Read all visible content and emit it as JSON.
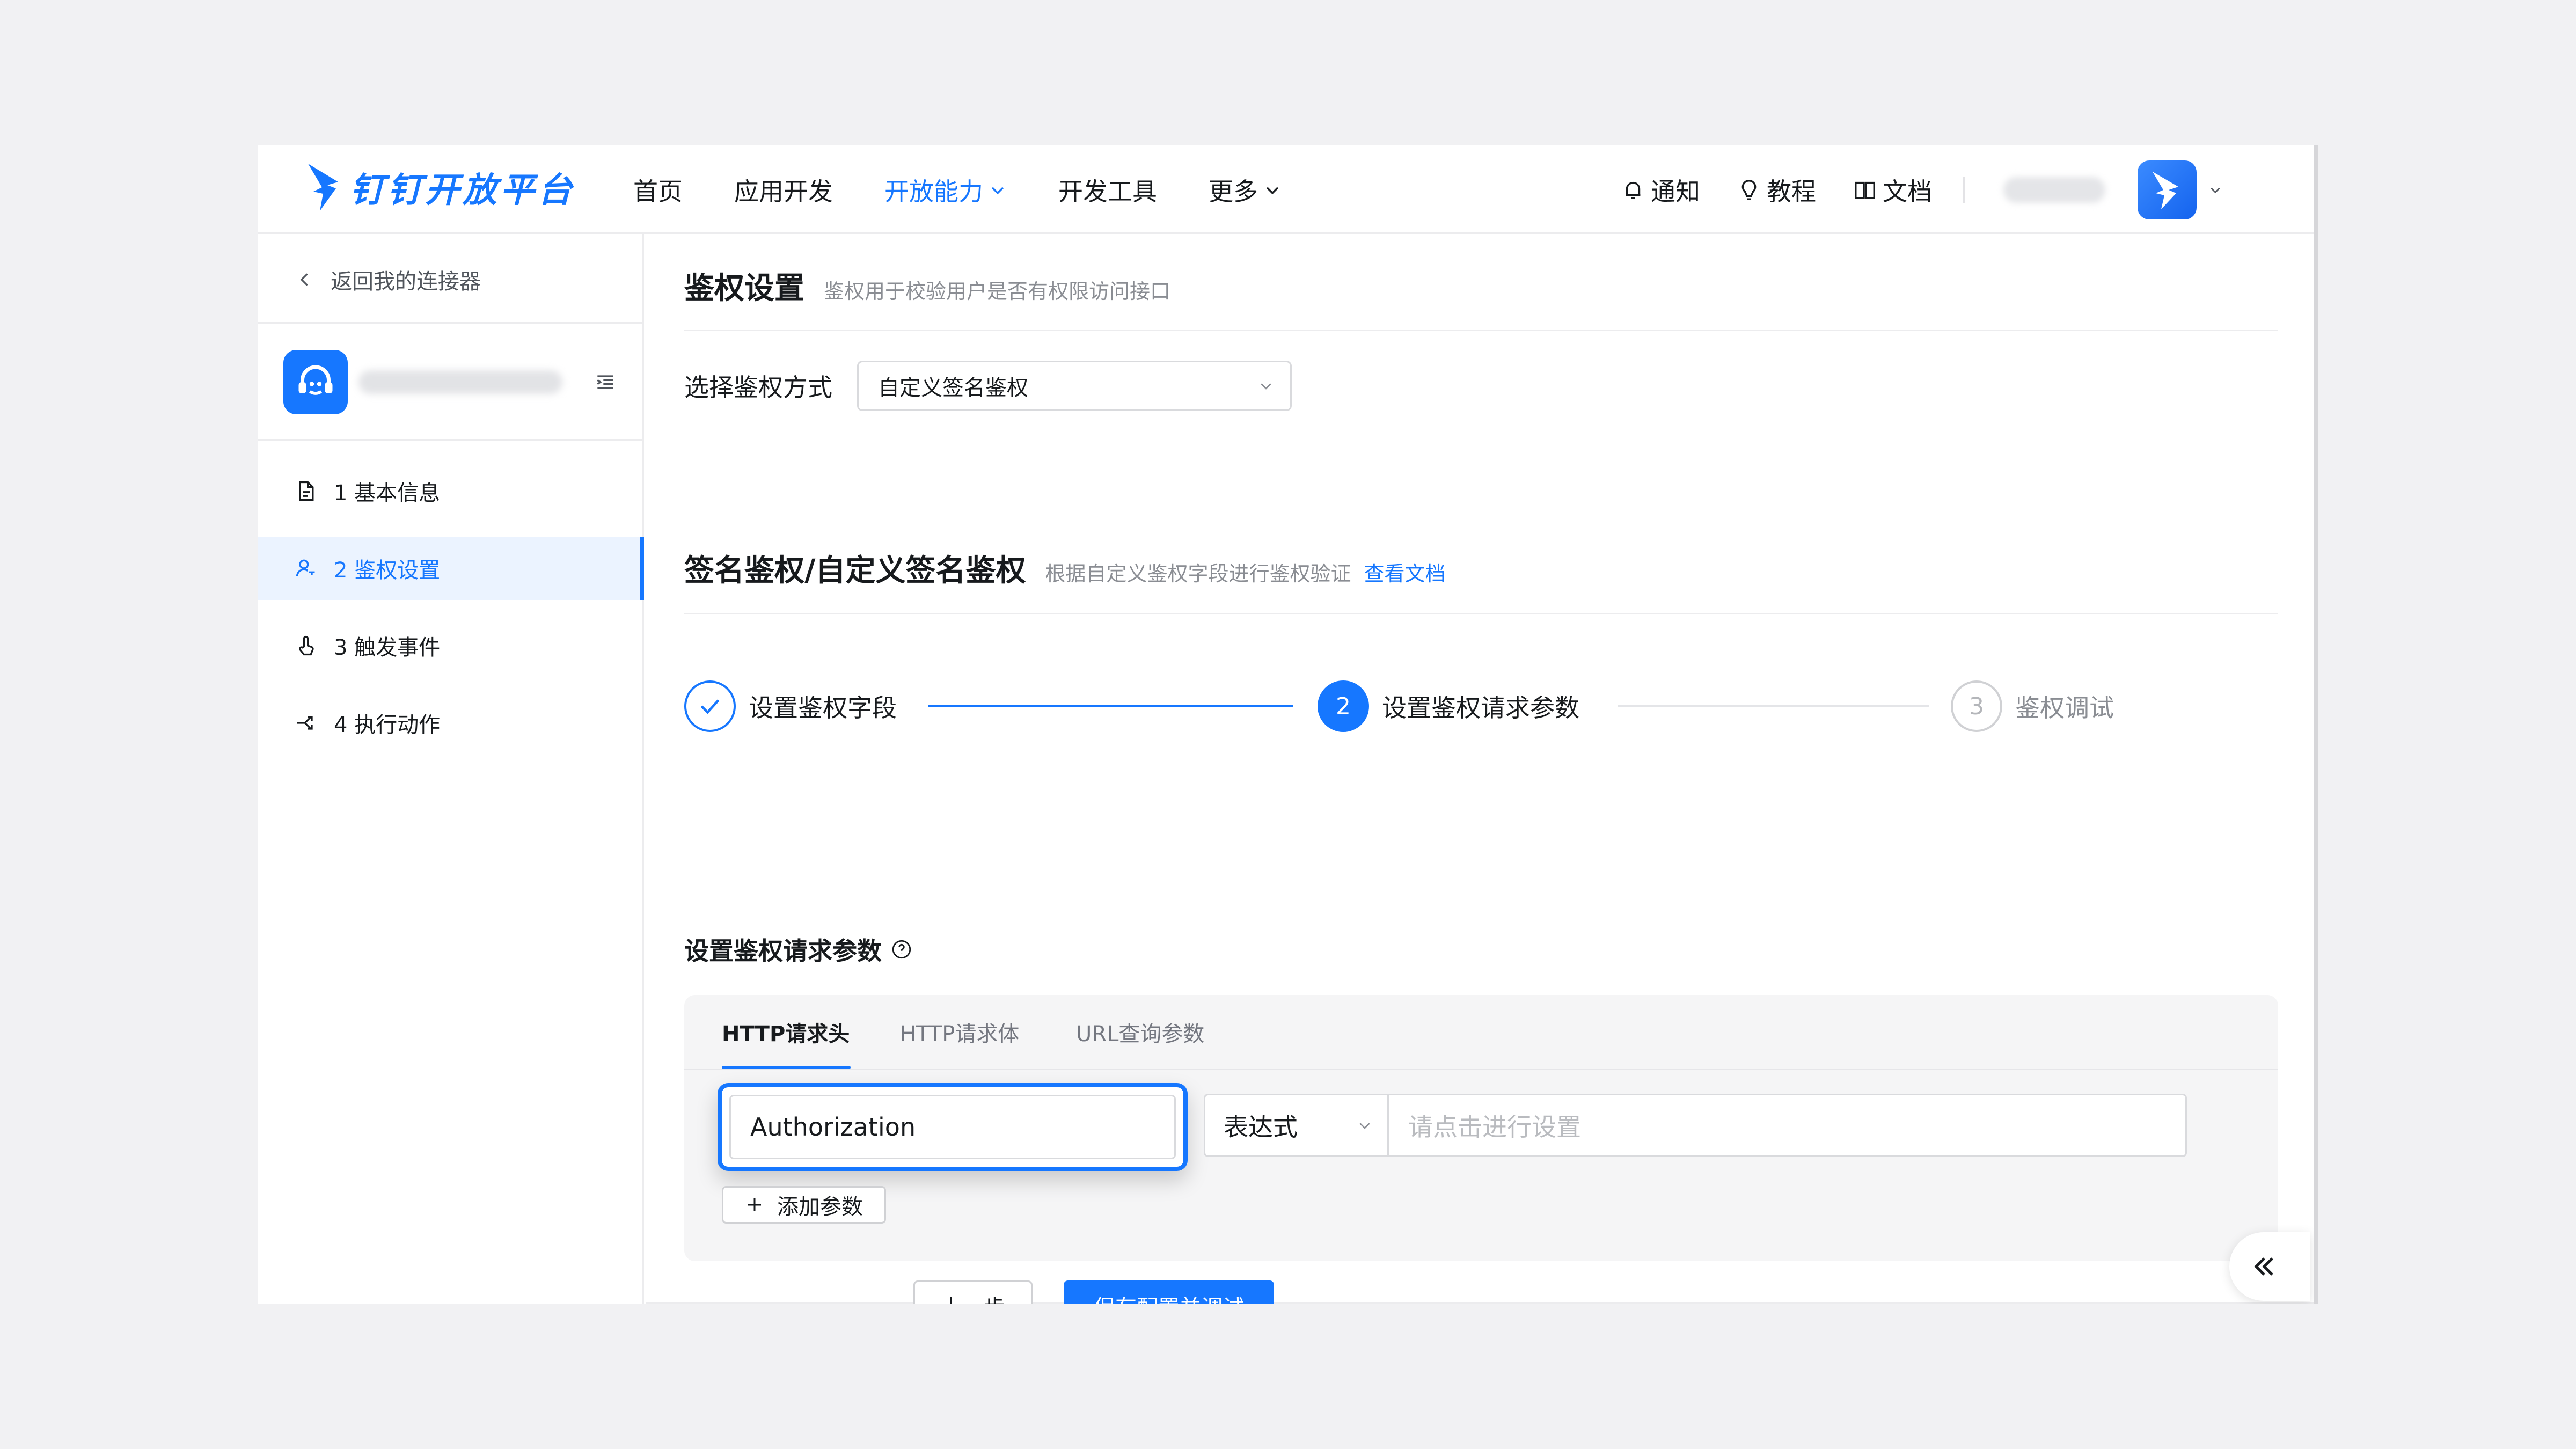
{
  "brand": {
    "name": "钉钉开放平台",
    "color": "#1677ff"
  },
  "topnav": {
    "items": [
      {
        "label": "首页",
        "active": false
      },
      {
        "label": "应用开发",
        "active": false
      },
      {
        "label": "开放能力",
        "active": true,
        "dropdown": true
      },
      {
        "label": "开发工具",
        "active": false
      },
      {
        "label": "更多",
        "active": false,
        "dropdown": true
      }
    ],
    "right": [
      {
        "label": "通知",
        "icon": "bell-icon"
      },
      {
        "label": "教程",
        "icon": "bulb-icon"
      },
      {
        "label": "文档",
        "icon": "book-icon"
      }
    ]
  },
  "sidebar": {
    "back_label": "返回我的连接器",
    "menu": [
      {
        "label": "1 基本信息",
        "icon": "document-icon",
        "active": false
      },
      {
        "label": "2 鉴权设置",
        "icon": "user-key-icon",
        "active": true
      },
      {
        "label": "3 触发事件",
        "icon": "pointer-icon",
        "active": false
      },
      {
        "label": "4 执行动作",
        "icon": "action-icon",
        "active": false
      }
    ]
  },
  "auth_section": {
    "title": "鉴权设置",
    "description": "鉴权用于校验用户是否有权限访问接口",
    "method_label": "选择鉴权方式",
    "method_value": "自定义签名鉴权"
  },
  "sign_section": {
    "title": "签名鉴权/自定义签名鉴权",
    "description": "根据自定义鉴权字段进行鉴权验证",
    "link": "查看文档"
  },
  "steps": [
    {
      "number": "1",
      "label": "设置鉴权字段",
      "status": "done"
    },
    {
      "number": "2",
      "label": "设置鉴权请求参数",
      "status": "current"
    },
    {
      "number": "3",
      "label": "鉴权调试",
      "status": "wait"
    }
  ],
  "params": {
    "title": "设置鉴权请求参数",
    "tabs": [
      "HTTP请求头",
      "HTTP请求体",
      "URL查询参数"
    ],
    "active_tab": "HTTP请求头",
    "row": {
      "name_value": "Authorization",
      "type_value": "表达式",
      "value_placeholder": "请点击进行设置"
    },
    "add_label": "添加参数"
  },
  "footer": {
    "prev_label": "上一步",
    "save_label": "保存配置并调试"
  }
}
